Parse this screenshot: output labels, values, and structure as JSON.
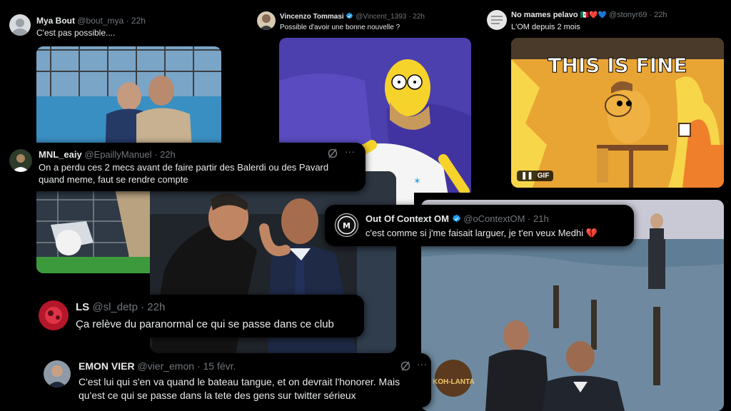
{
  "tweets": [
    {
      "name": "Mya Bout",
      "handle": "@bout_mya",
      "time": "22h",
      "text": "C'est pas possible....",
      "verified": false
    },
    {
      "name": "Vincenzo Tommasi",
      "handle": "@Vincent_1393",
      "time": "22h",
      "text": "Possible d'avoir une bonne nouvelle ?",
      "verified": true
    },
    {
      "name": "No mames pelavo",
      "emoji": "🇲🇽❤️💙",
      "handle": "@stonyr69",
      "time": "22h",
      "text": "L'OM depuis 2 mois",
      "verified": false
    },
    {
      "name": "MNL_eaiy",
      "handle": "@EpaillyManuel",
      "time": "22h",
      "text_line1": "On a perdu ces 2 mecs avant de faire partir des Balerdi ou des Pavard",
      "text_line2": "quand meme, faut se rendre compte",
      "verified": false
    },
    {
      "name": "Out Of Context OM",
      "handle": "@oContextOM",
      "time": "21h",
      "text": "c'est comme si j'me faisait larguer, je t'en veux Medhi 💔",
      "verified": true
    },
    {
      "name": "LS",
      "handle": "@sl_detp",
      "time": "22h",
      "text": "Ça relève du paranormal ce qui se passe dans ce club",
      "verified": false
    },
    {
      "name": "EMON VIER",
      "handle": "@vier_emon",
      "time": "15 févr.",
      "text_line1": "C'est lui qui s'en va quand le bateau tangue, et on devrait l'honorer. Mais",
      "text_line2": "qu'est ce qui se passe dans la tete des gens sur twitter sérieux",
      "verified": false
    }
  ],
  "media": {
    "meme_caption": "THIS IS FINE",
    "gif_label": "GIF",
    "koh_lanta": "KOH-LANTA"
  },
  "colors": {
    "verified": "#1d9bf0",
    "background": "#000000",
    "muted": "#71767b",
    "text": "#e7e9ea"
  }
}
